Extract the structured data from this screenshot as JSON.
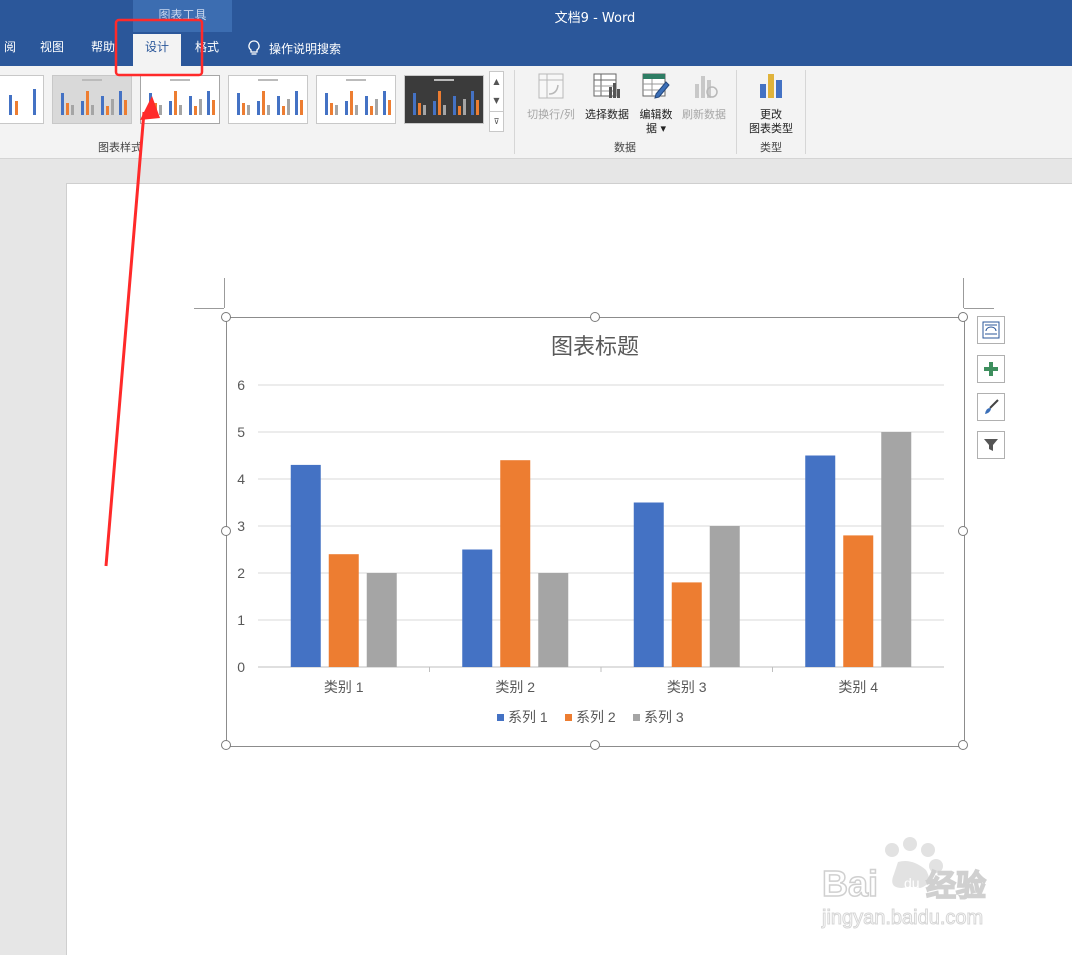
{
  "window": {
    "title": "文档9  -  Word",
    "context_tools": "图表工具"
  },
  "tabs": [
    {
      "label": "阅"
    },
    {
      "label": "视图"
    },
    {
      "label": "帮助"
    },
    {
      "label": "设计",
      "selected": true
    },
    {
      "label": "格式"
    }
  ],
  "tell_me": {
    "label": "操作说明搜索",
    "icon": "lightbulb-icon"
  },
  "ribbon": {
    "chart_styles_label": "图表样式",
    "data_group_label": "数据",
    "type_group_label": "类型",
    "buttons": {
      "switch_row_col": "切换行/列",
      "select_data": "选择数据",
      "edit_data_line1": "编辑数",
      "edit_data_line2": "据 ▾",
      "refresh_data": "刷新数据",
      "change_type_line1": "更改",
      "change_type_line2": "图表类型"
    }
  },
  "colors": {
    "accent": "#2b579a",
    "series1": "#4472c4",
    "series2": "#ed7d31",
    "series3": "#a5a5a5",
    "annotation": "#ff2a2a"
  },
  "chart_data": {
    "type": "bar",
    "title": "图表标题",
    "categories": [
      "类别 1",
      "类别 2",
      "类别 3",
      "类别 4"
    ],
    "series": [
      {
        "name": "系列 1",
        "values": [
          4.3,
          2.5,
          3.5,
          4.5
        ],
        "color": "#4472c4"
      },
      {
        "name": "系列 2",
        "values": [
          2.4,
          4.4,
          1.8,
          2.8
        ],
        "color": "#ed7d31"
      },
      {
        "name": "系列 3",
        "values": [
          2,
          2,
          3,
          5
        ],
        "color": "#a5a5a5"
      }
    ],
    "ylim": [
      0,
      6
    ],
    "yticks": [
      "0",
      "1",
      "2",
      "3",
      "4",
      "5",
      "6"
    ],
    "grid": true,
    "legend": "bottom"
  },
  "chart_side_buttons": [
    "chart-layout-icon",
    "plus-icon",
    "brush-icon",
    "filter-icon"
  ],
  "watermark": {
    "brand": "Bai du 经验",
    "url": "jingyan.baidu.com"
  }
}
